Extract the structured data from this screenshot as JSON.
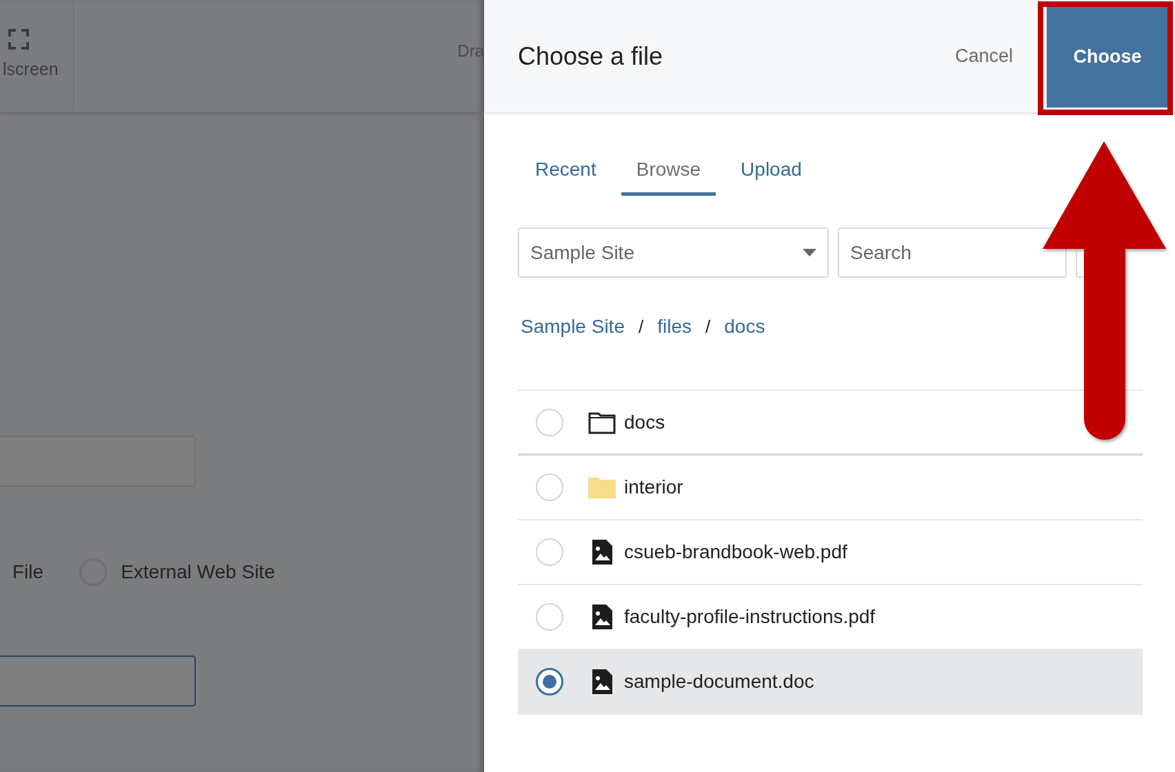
{
  "background": {
    "toolbar": {
      "fullscreen_label": "lscreen",
      "cut_label": "Dra"
    },
    "link_options": [
      {
        "label": "File",
        "kind": "cut"
      },
      {
        "label": "External Web Site",
        "kind": "radio",
        "selected": false
      }
    ]
  },
  "dialog": {
    "title": "Choose a file",
    "cancel": "Cancel",
    "choose": "Choose",
    "tabs": [
      {
        "label": "Recent",
        "selected": false
      },
      {
        "label": "Browse",
        "selected": true
      },
      {
        "label": "Upload",
        "selected": false
      }
    ],
    "site_select": {
      "value": "Sample Site"
    },
    "search": {
      "placeholder": "Search"
    },
    "breadcrumb": [
      {
        "label": "Sample Site"
      },
      {
        "separator": "/",
        "label": "files"
      },
      {
        "separator": "/",
        "label": "docs"
      }
    ],
    "items": [
      {
        "name": "docs",
        "kind": "current_folder",
        "selected": false
      },
      {
        "name": "interior",
        "kind": "folder",
        "selected": false
      },
      {
        "name": "csueb-brandbook-web.pdf",
        "kind": "file",
        "selected": false
      },
      {
        "name": "faculty-profile-instructions.pdf",
        "kind": "file",
        "selected": false
      },
      {
        "name": "sample-document.doc",
        "kind": "file",
        "selected": true
      }
    ]
  }
}
